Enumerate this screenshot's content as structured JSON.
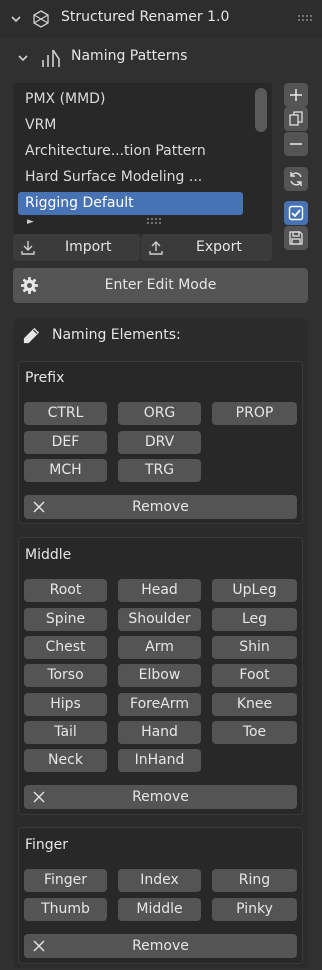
{
  "header": {
    "title": "Structured Renamer 1.0"
  },
  "subpanel": {
    "title": "Naming Patterns"
  },
  "patterns": {
    "items": [
      "PMX (MMD)",
      "VRM",
      "Architecture...tion Pattern",
      "Hard Surface Modeling ...",
      "Rigging Default"
    ],
    "selected": "Rigging Default"
  },
  "list_footer": {
    "expand_arrow": "►"
  },
  "io": {
    "import_label": "Import",
    "export_label": "Export"
  },
  "side_tools": {
    "add": "plus-icon",
    "duplicate": "copy-icon",
    "remove": "minus-icon",
    "refresh": "refresh-icon",
    "toggle": "checkbox-icon",
    "save": "save-icon"
  },
  "edit_mode": {
    "label": "Enter Edit Mode"
  },
  "elements": {
    "title": "Naming Elements:",
    "remove_label": "Remove",
    "prefix": {
      "title": "Prefix",
      "items": [
        "CTRL",
        "ORG",
        "PROP",
        "DEF",
        "DRV",
        "MCH",
        "TRG"
      ]
    },
    "middle": {
      "title": "Middle",
      "items": [
        "Root",
        "Head",
        "UpLeg",
        "Spine",
        "Shoulder",
        "Leg",
        "Chest",
        "Arm",
        "Shin",
        "Torso",
        "Elbow",
        "Foot",
        "Hips",
        "ForeArm",
        "Knee",
        "Tail",
        "Hand",
        "Toe",
        "Neck",
        "InHand"
      ]
    },
    "finger": {
      "title": "Finger",
      "items": [
        "Finger",
        "Index",
        "Ring",
        "Thumb",
        "Middle",
        "Pinky"
      ]
    }
  },
  "colors": {
    "accent": "#4772b3",
    "button": "#545454",
    "panel": "#2b2b2b",
    "background": "#303030"
  }
}
